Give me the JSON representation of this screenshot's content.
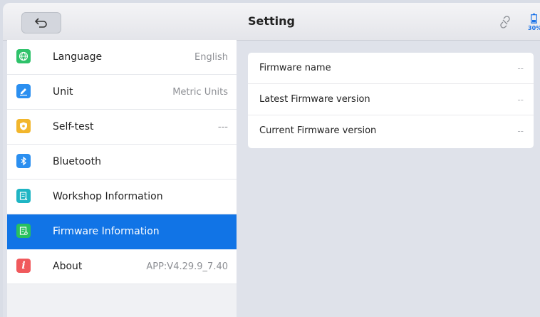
{
  "header": {
    "title": "Setting",
    "battery_percent": "30%"
  },
  "sidebar": {
    "items": [
      {
        "label": "Language",
        "value": "English",
        "icon": "globe-icon",
        "color": "#2ec26a"
      },
      {
        "label": "Unit",
        "value": "Metric Units",
        "icon": "pencil-icon",
        "color": "#2b8ff0"
      },
      {
        "label": "Self-test",
        "value": "---",
        "icon": "shield-icon",
        "color": "#f2b62c"
      },
      {
        "label": "Bluetooth",
        "value": "",
        "icon": "bluetooth-icon",
        "color": "#2b8ff0"
      },
      {
        "label": "Workshop Information",
        "value": "",
        "icon": "document-icon",
        "color": "#1fb5c4"
      },
      {
        "label": "Firmware Information",
        "value": "",
        "icon": "firmware-icon",
        "color": "#28c15e",
        "selected": true
      },
      {
        "label": "About",
        "value": "APP:V4.29.9_7.40",
        "icon": "info-icon",
        "color": "#f0595c"
      }
    ]
  },
  "firmware": {
    "rows": [
      {
        "label": "Firmware name",
        "value": "--"
      },
      {
        "label": "Latest Firmware version",
        "value": "--"
      },
      {
        "label": "Current Firmware version",
        "value": "--"
      }
    ]
  },
  "colors": {
    "accent": "#1174e6",
    "background": "#dfe2ea"
  }
}
